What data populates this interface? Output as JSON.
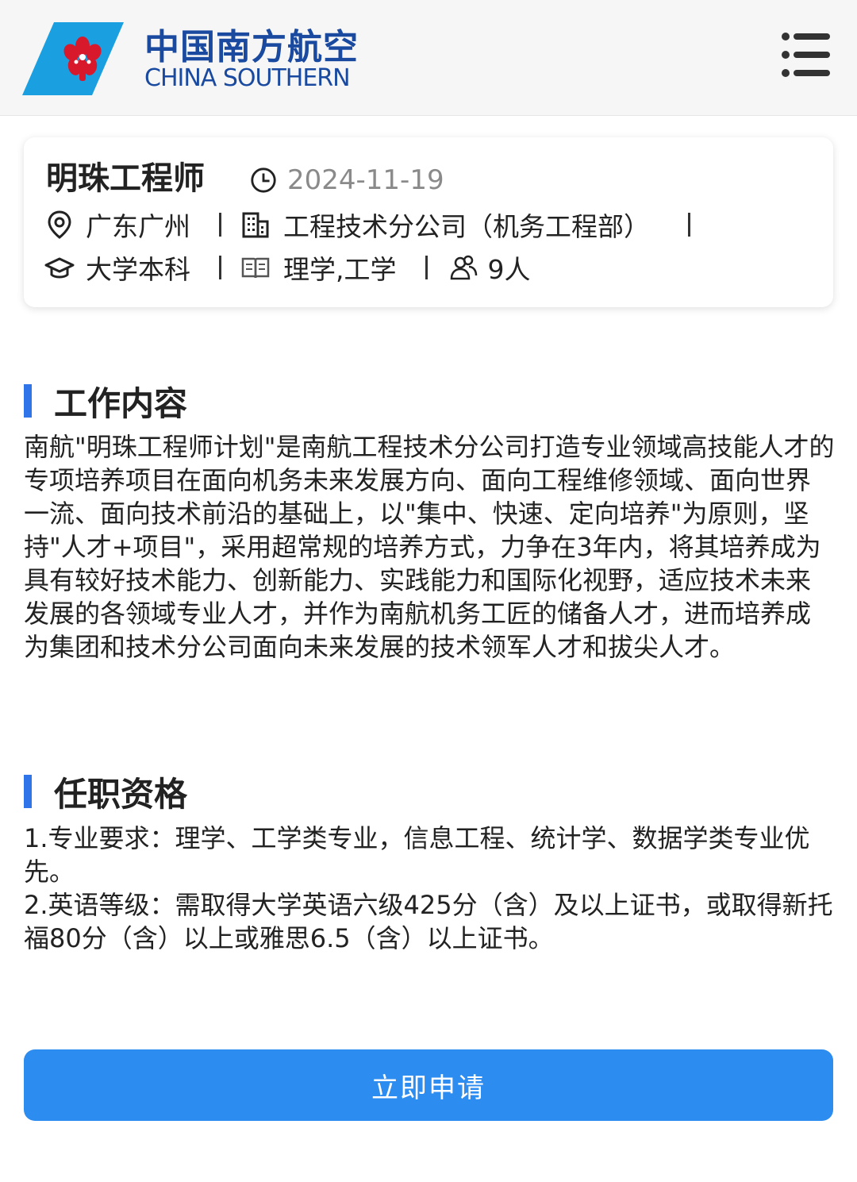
{
  "header": {
    "brand_cn": "中国南方航空",
    "brand_en": "CHINA SOUTHERN",
    "logo_icon": "china-southern-kapok-logo",
    "menu_icon": "menu-icon",
    "brand_color": "#1a4aa0",
    "logo_bg_color": "#1aa0e0",
    "logo_flower_color": "#d8192c"
  },
  "job": {
    "title": "明珠工程师",
    "date": "2024-11-19",
    "location": "广东广州",
    "company": "工程技术分公司（机务工程部）",
    "education": "大学本科",
    "major": "理学,工学",
    "headcount": "9人"
  },
  "sections": {
    "work": {
      "heading": "工作内容",
      "paragraphs": [
        "南航\"明珠工程师计划\"是南航工程技术分公司打造专业领域高技能人才的专项培养项目在面向机务未来发展方向、面向工程维修领域、面向世界一流、面向技术前沿的基础上，以\"集中、快速、定向培养\"为原则，坚持\"人才+项目\"，采用超常规的培养方式，力争在3年内，将其培养成为具有较好技术能力、创新能力、实践能力和国际化视野，适应技术未来发展的各领域专业人才，并作为南航机务工匠的储备人才，进而培养成为集团和技术分公司面向未来发展的技术领军人才和拔尖人才。"
      ]
    },
    "qualification": {
      "heading": "任职资格",
      "items": [
        "1.专业要求：理学、工学类专业，信息工程、统计学、数据学类专业优先。",
        "2.英语等级：需取得大学英语六级425分（含）及以上证书，或取得新托福80分（含）以上或雅思6.5（含）以上证书。"
      ]
    }
  },
  "apply_button": {
    "label": "立即申请",
    "color": "#2d8cf0"
  },
  "accent_color": "#2f74e8"
}
